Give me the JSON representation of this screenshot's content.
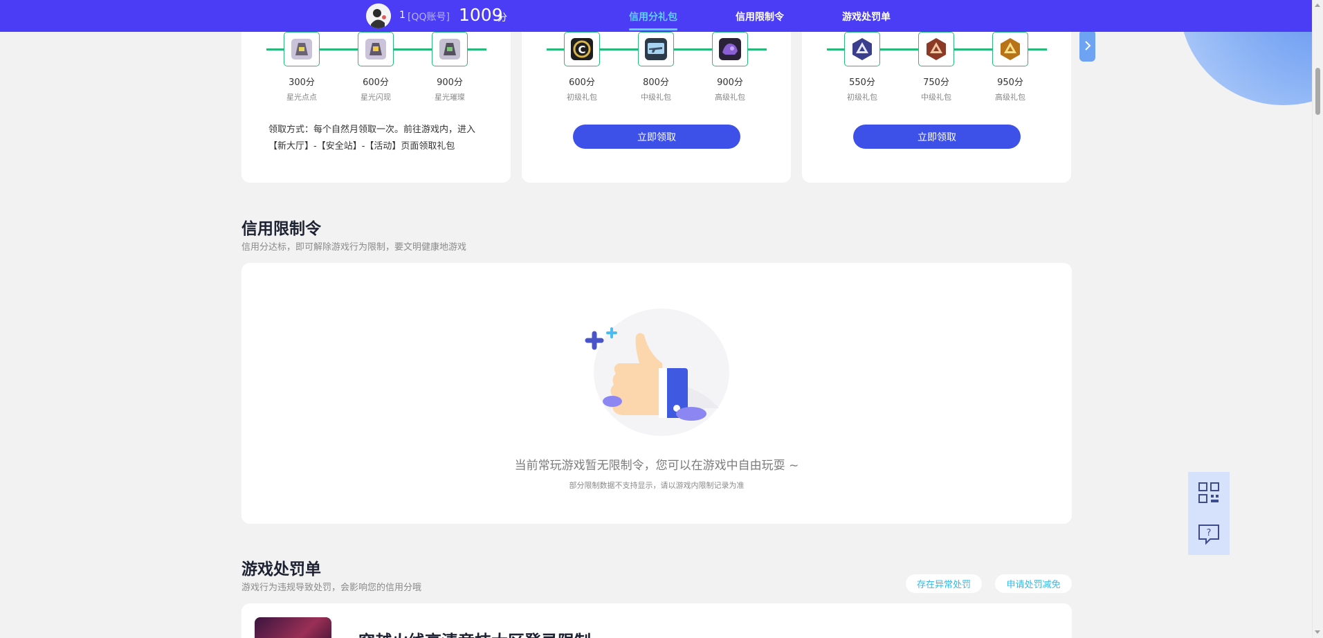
{
  "header": {
    "user_id": "1",
    "account_type": "[QQ账号]",
    "score": "1009",
    "score_unit": "分",
    "tabs": [
      {
        "label": "信用分礼包",
        "active": true
      },
      {
        "label": "信用限制令",
        "active": false
      },
      {
        "label": "游戏处罚单",
        "active": false
      }
    ]
  },
  "gift_cards": [
    {
      "items": [
        {
          "points": "300分",
          "name": "星光点点",
          "icon": "backpack-skin-icon"
        },
        {
          "points": "600分",
          "name": "星光闪现",
          "icon": "backpack-skin-icon"
        },
        {
          "points": "900分",
          "name": "星光璀璨",
          "icon": "backpack-skin-icon"
        }
      ],
      "claim_text": "领取方式：每个自然月领取一次。前往游戏内，进入【新大厅】-【安全站】-【活动】页面领取礼包"
    },
    {
      "items": [
        {
          "points": "600分",
          "name": "初级礼包",
          "icon": "cf-logo-icon"
        },
        {
          "points": "800分",
          "name": "中级礼包",
          "icon": "rifle-icon"
        },
        {
          "points": "900分",
          "name": "高级礼包",
          "icon": "armor-icon"
        }
      ],
      "button_label": "立即领取"
    },
    {
      "items": [
        {
          "points": "550分",
          "name": "初级礼包",
          "icon": "rank-badge-icon"
        },
        {
          "points": "750分",
          "name": "中级礼包",
          "icon": "rank-badge-icon"
        },
        {
          "points": "950分",
          "name": "高级礼包",
          "icon": "rank-badge-icon"
        }
      ],
      "button_label": "立即领取"
    }
  ],
  "restriction": {
    "title": "信用限制令",
    "subtitle": "信用分达标，即可解除游戏行为限制，要文明健康地游戏",
    "empty_message": "当前常玩游戏暂无限制令，您可以在游戏中自由玩耍 ~",
    "empty_note": "部分限制数据不支持显示，请以游戏内限制记录为准"
  },
  "penalty": {
    "title": "游戏处罚单",
    "subtitle": "游戏行为违规导致处罚，会影响您的信用分哦",
    "action_abnormal": "存在异常处罚",
    "action_appeal": "申请处罚减免",
    "item_title": "穿越火线高清竞技大区登录限制"
  },
  "colors": {
    "nav_bg": "#4a3df5",
    "active_tab": "#5fd1f3",
    "button_blue": "#3d51e9",
    "progress_green": "#27b979",
    "link_cyan": "#38b8e3"
  }
}
